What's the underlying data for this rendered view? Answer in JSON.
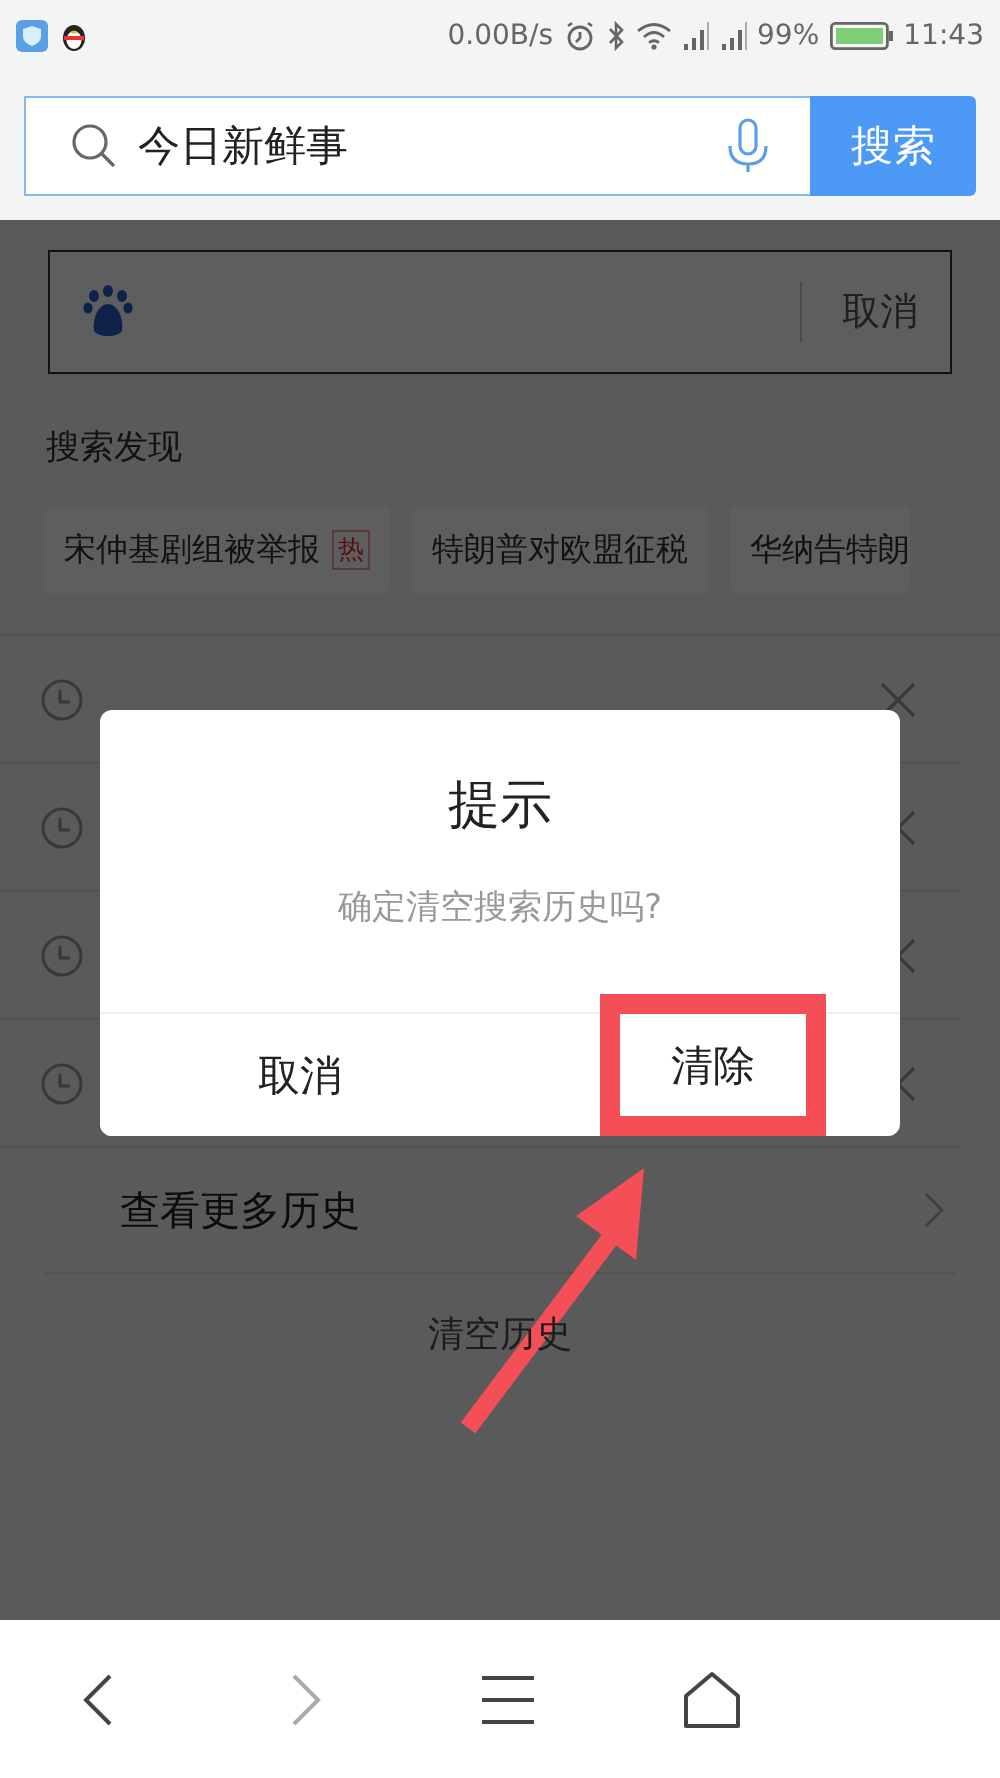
{
  "status_bar": {
    "net_speed": "0.00B/s",
    "battery": "99%",
    "time": "11:43"
  },
  "search_bar": {
    "value": "今日新鲜事",
    "button": "搜索"
  },
  "baidu_box": {
    "cancel": "取消"
  },
  "discover": {
    "title": "搜索发现",
    "chips": [
      {
        "text": "宋仲基剧组被举报",
        "hot": true,
        "badge": "热"
      },
      {
        "text": "特朗普对欧盟征税",
        "hot": false
      },
      {
        "text": "华纳告特朗",
        "hot": false
      }
    ]
  },
  "history": {
    "items": [
      {
        "removable": true
      },
      {
        "removable": true
      },
      {
        "removable": true
      },
      {
        "removable": true
      }
    ],
    "more": "查看更多历史",
    "clear": "清空历史"
  },
  "dialog": {
    "title": "提示",
    "message": "确定清空搜索历史吗?",
    "buttons": [
      {
        "label": "取消",
        "highlighted": false
      },
      {
        "label": "清除",
        "highlighted": true
      }
    ]
  },
  "bottom_nav": [
    {
      "kind": "back",
      "disabled": false
    },
    {
      "kind": "forward",
      "disabled": true
    },
    {
      "kind": "menu",
      "disabled": false
    },
    {
      "kind": "home",
      "disabled": false
    }
  ]
}
